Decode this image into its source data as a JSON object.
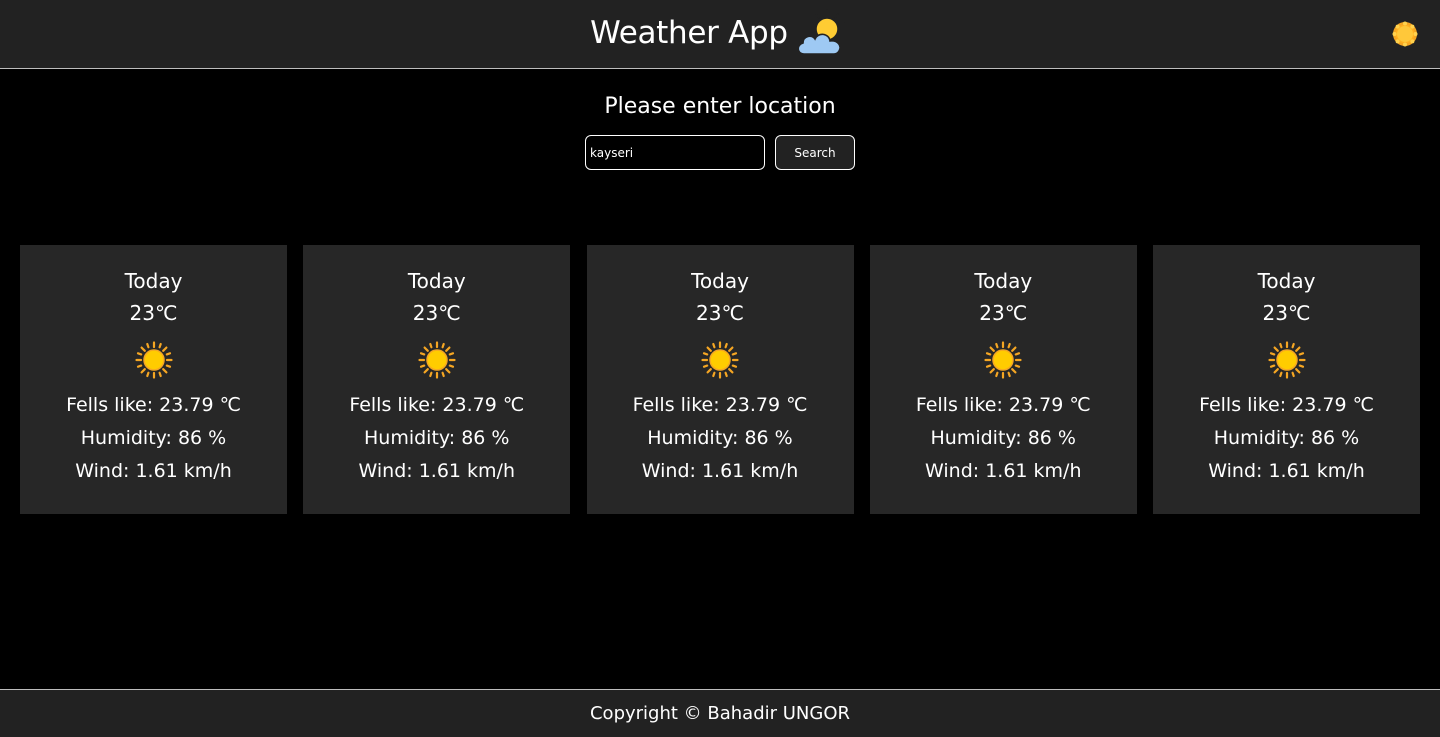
{
  "header": {
    "title": "Weather App",
    "logo_icon": "sun-cloud-icon",
    "theme_toggle_icon": "sun-icon"
  },
  "search": {
    "prompt": "Please enter location",
    "value": "kayseri",
    "button_label": "Search"
  },
  "forecast": [
    {
      "day": "Today",
      "temp": "23℃",
      "icon": "sun-icon",
      "feels_like": "Fells like: 23.79 ℃",
      "humidity": "Humidity: 86 %",
      "wind": "Wind: 1.61 km/h"
    },
    {
      "day": "Today",
      "temp": "23℃",
      "icon": "sun-icon",
      "feels_like": "Fells like: 23.79 ℃",
      "humidity": "Humidity: 86 %",
      "wind": "Wind: 1.61 km/h"
    },
    {
      "day": "Today",
      "temp": "23℃",
      "icon": "sun-icon",
      "feels_like": "Fells like: 23.79 ℃",
      "humidity": "Humidity: 86 %",
      "wind": "Wind: 1.61 km/h"
    },
    {
      "day": "Today",
      "temp": "23℃",
      "icon": "sun-icon",
      "feels_like": "Fells like: 23.79 ℃",
      "humidity": "Humidity: 86 %",
      "wind": "Wind: 1.61 km/h"
    },
    {
      "day": "Today",
      "temp": "23℃",
      "icon": "sun-icon",
      "feels_like": "Fells like: 23.79 ℃",
      "humidity": "Humidity: 86 %",
      "wind": "Wind: 1.61 km/h"
    }
  ],
  "footer": {
    "copyright": "Copyright © Bahadir UNGOR"
  },
  "colors": {
    "background": "#000000",
    "bar": "#222222",
    "card": "#272727",
    "sun": "#ffcc00",
    "sun_rays": "#f5a623"
  }
}
